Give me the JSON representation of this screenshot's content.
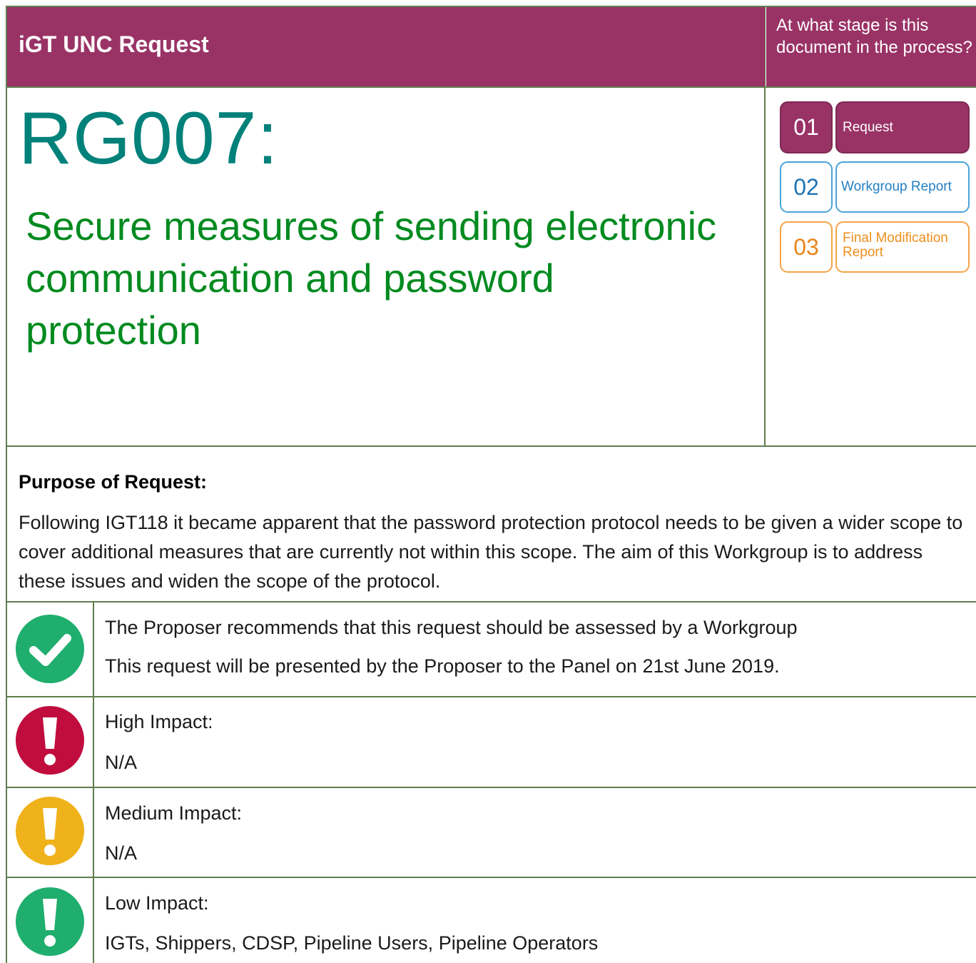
{
  "header": {
    "title": "iGT UNC Request",
    "stage_question": "At what stage is this document in the process?"
  },
  "modification": {
    "number": "RG007:",
    "title": "Secure measures of sending electronic communication and password protection"
  },
  "stages": [
    {
      "number": "01",
      "label": "Request",
      "state": "current"
    },
    {
      "number": "02",
      "label": "Workgroup Report",
      "state": "upcoming"
    },
    {
      "number": "03",
      "label": "Final Modification Report",
      "state": "upcoming"
    }
  ],
  "purpose": {
    "heading": "Purpose of Request:",
    "body": "Following IGT118 it became apparent that the password protection protocol needs to be given a wider scope to cover additional measures that are currently not within this scope. The aim of this Workgroup is to address these issues and widen the scope of the protocol."
  },
  "rows": [
    {
      "icon": "check-icon",
      "line1": "The Proposer recommends that this request should be assessed by a Workgroup",
      "line2": "This request will be presented by the Proposer to the Panel on 21st June 2019."
    },
    {
      "icon": "high-impact-icon",
      "line1": "High Impact:",
      "line2": "N/A"
    },
    {
      "icon": "medium-impact-icon",
      "line1": "Medium Impact:",
      "line2": "N/A"
    },
    {
      "icon": "low-impact-icon",
      "line1": "Low Impact:",
      "line2": "IGTs, Shippers, CDSP, Pipeline Users, Pipeline Operators"
    }
  ],
  "colors": {
    "brand": "#993366",
    "title_teal": "#00817a",
    "title_green": "#008a1f",
    "border": "#5e7d4e",
    "check": "#1fae6e",
    "high": "#c00d3e",
    "medium": "#f0b21a",
    "low": "#1fae6e"
  }
}
